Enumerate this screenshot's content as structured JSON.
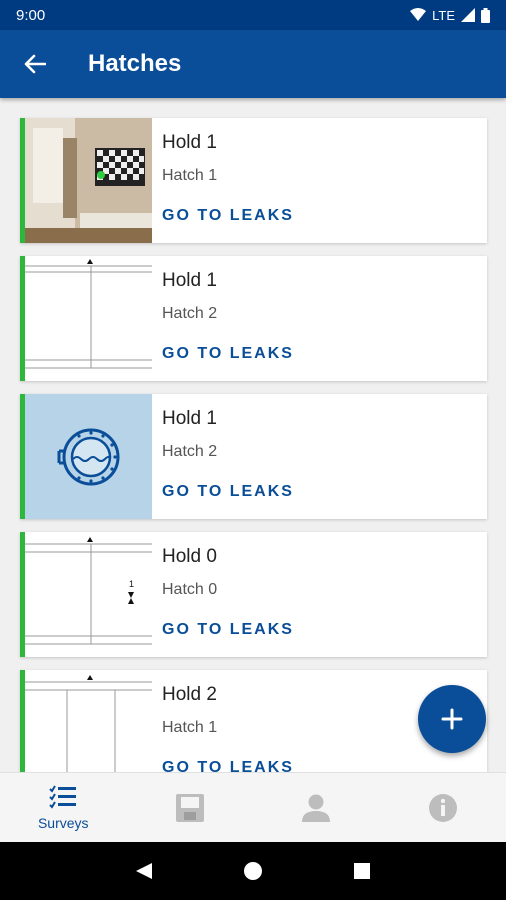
{
  "status": {
    "time": "9:00",
    "network": "LTE"
  },
  "app_bar": {
    "title": "Hatches"
  },
  "cards": [
    {
      "hold": "Hold 1",
      "hatch": "Hatch 1",
      "action": "GO TO LEAKS",
      "thumb": "photo"
    },
    {
      "hold": "Hold 1",
      "hatch": "Hatch 2",
      "action": "GO TO LEAKS",
      "thumb": "drawing"
    },
    {
      "hold": "Hold 1",
      "hatch": "Hatch 2",
      "action": "GO TO LEAKS",
      "thumb": "porthole-icon"
    },
    {
      "hold": "Hold 0",
      "hatch": "Hatch 0",
      "action": "GO TO LEAKS",
      "thumb": "drawing",
      "drawing_label": "1"
    },
    {
      "hold": "Hold 2",
      "hatch": "Hatch 1",
      "action": "GO TO LEAKS",
      "thumb": "drawing"
    }
  ],
  "bottom_nav": {
    "items": [
      {
        "label": "Surveys",
        "icon": "checklist-icon",
        "active": true
      },
      {
        "label": "",
        "icon": "floppy-icon"
      },
      {
        "label": "",
        "icon": "person-icon"
      },
      {
        "label": "",
        "icon": "info-icon"
      }
    ]
  },
  "colors": {
    "primary": "#0a4d98",
    "accent_green": "#2db83d"
  }
}
